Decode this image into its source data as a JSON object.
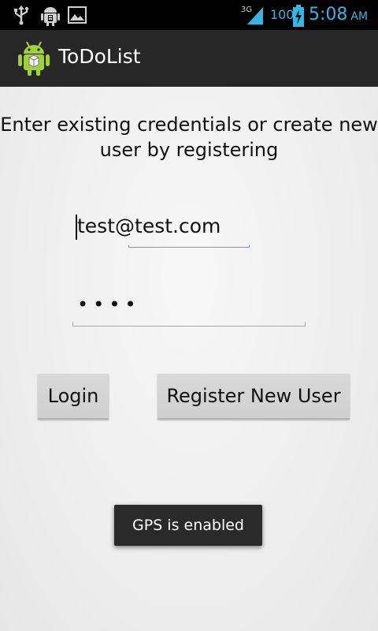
{
  "status_bar": {
    "network_label": "3G",
    "battery_level": "100",
    "time": "5:08",
    "ampm": "AM",
    "accent_color": "#33b5e5",
    "icons": [
      "usb-icon",
      "android-debug-icon",
      "image-icon",
      "signal-icon",
      "battery-charging-icon"
    ]
  },
  "action_bar": {
    "title": "ToDoList",
    "icon": "android-app-icon"
  },
  "login_form": {
    "instructions": "Enter existing credentials or create new user by registering",
    "email_value": "test@test.com",
    "password_mask": "••••",
    "login_label": "Login",
    "register_label": "Register New User"
  },
  "toast": {
    "message": "GPS is enabled"
  },
  "colors": {
    "focus_underline": "#33b5e5",
    "action_bar_bg": "#272727"
  }
}
